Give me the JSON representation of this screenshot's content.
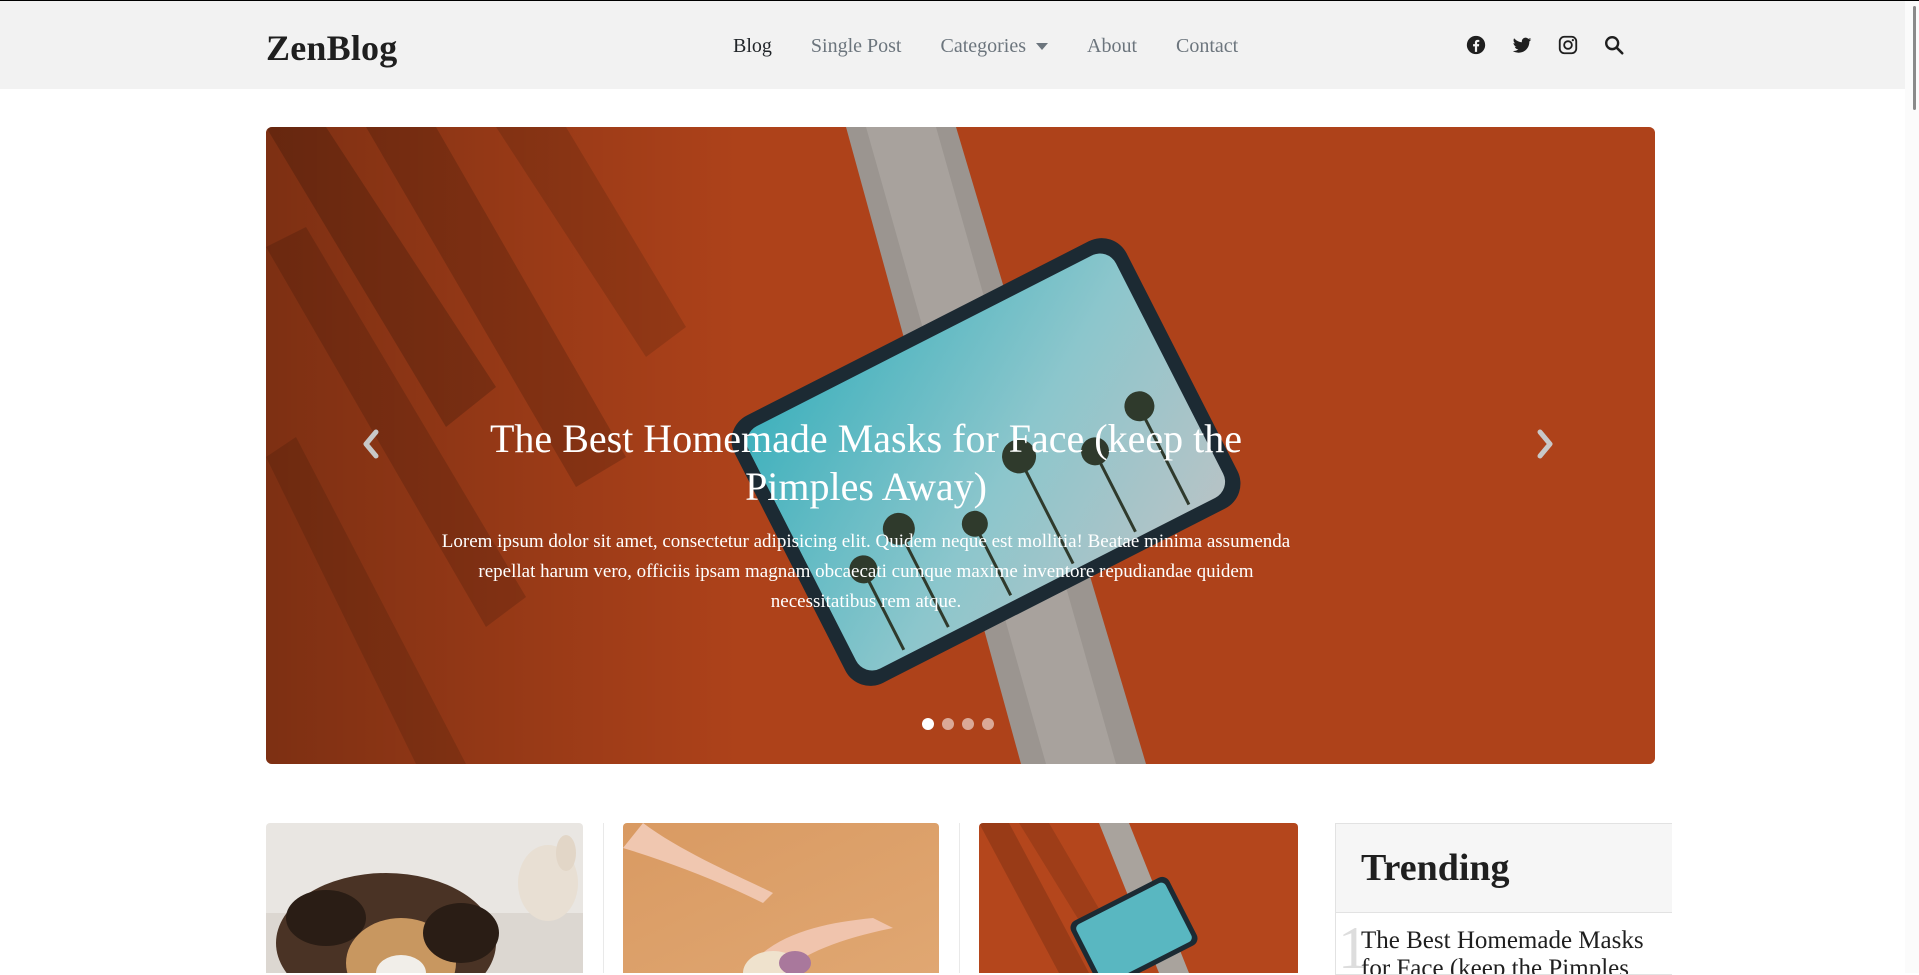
{
  "brand": {
    "logo": "ZenBlog"
  },
  "nav": {
    "blog": "Blog",
    "single_post": "Single Post",
    "categories": "Categories",
    "about": "About",
    "contact": "Contact"
  },
  "header_icons": [
    "facebook-icon",
    "twitter-icon",
    "instagram-icon",
    "search-icon"
  ],
  "hero": {
    "title": "The Best Homemade Masks for Face (keep the Pimples Away)",
    "text": "Lorem ipsum dolor sit amet, consectetur adipisicing elit. Quidem neque est mollitia! Beatae minima assumenda repellat harum vero, officiis ipsam magnam obcaecati cumque maxime inventore repudiandae quidem necessitatibus rem atque.",
    "slide_count": 4,
    "active_slide": 1
  },
  "trending": {
    "heading": "Trending",
    "first_number": "1",
    "first_post": "The Best Homemade Masks for Face (keep the Pimples Away)"
  },
  "colors": {
    "navbar_bg": "#f2f2f2",
    "hero_track": "#b4461c",
    "accent_text": "#212529",
    "muted_text": "#6c757d"
  }
}
